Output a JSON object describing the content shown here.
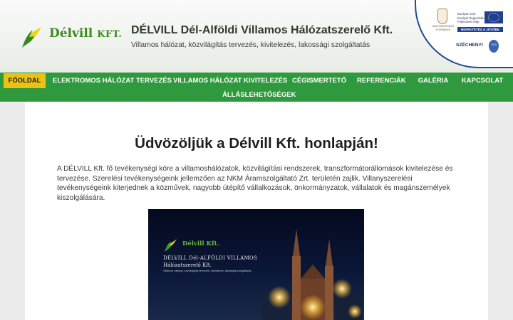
{
  "brand": {
    "name": "Délvill",
    "suffix": "KFT."
  },
  "header": {
    "title": "DÉLVILL Dél-Alföldi Villamos Hálózatszerelő Kft.",
    "subtitle": "Villamos hálózat, közvilágítás tervezés, kivitelezés, lakossági szolgáltatás"
  },
  "eu_badge": {
    "gov_text": "MAGYARORSZÁG KORMÁNYA",
    "eu_lines": [
      "Európai Unió",
      "Európai Regionális",
      "Fejlesztési Alap"
    ],
    "bar_text": "BEFEKTETÉS A JÖVŐBE",
    "szechenyi": "SZÉCHENYI",
    "year": "2020"
  },
  "nav": {
    "items": [
      {
        "label": "FŐOLDAL",
        "active": true
      },
      {
        "label": "ELEKTROMOS HÁLÓZAT TERVEZÉS",
        "active": false
      },
      {
        "label": "VILLAMOS HÁLÓZAT KIVITELEZÉS",
        "active": false
      },
      {
        "label": "CÉGISMERTETŐ",
        "active": false
      },
      {
        "label": "REFERENCIÁK",
        "active": false
      },
      {
        "label": "GALÉRIA",
        "active": false
      },
      {
        "label": "KAPCSOLAT",
        "active": false
      },
      {
        "label": "ÁLLÁSLEHETŐSÉGEK",
        "active": false
      }
    ]
  },
  "main": {
    "heading": "Üdvözöljük a Délvill Kft. honlapján!",
    "intro": "A DÉLVILL Kft. fő tevékenységi köre a villamoshálózatok, közvilágítási rendszerek, transzformátorállomások kivitelezése és tervezése. Szerelési tevékenységeink jellemzően az NKM Áramszolgáltató Zrt. területén zajlik. Villanyszerelési tevékenységeink kiterjednek a közművek, nagyobb útépítő vállalkozások, önkormányzatok, vállalatok és magánszemélyek kiszolgálására."
  },
  "promo": {
    "brand": "Délvill Kft.",
    "line1": "DÉLVILL Dél-ALFÖLDI VILLAMOS",
    "line2": "Hálózatszerelő Kft.",
    "line3": "Villamos hálózat, közvilágítás tervezés, kivitelezés, lakossági szolgáltatás"
  },
  "colors": {
    "nav_bg": "#2f9a3d",
    "nav_active": "#ecc116",
    "brand_green": "#3b8a1e"
  }
}
